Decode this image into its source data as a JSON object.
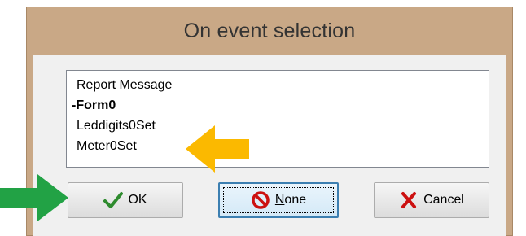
{
  "dialog": {
    "title": "On event selection"
  },
  "event_list": {
    "items": [
      {
        "label": "Report Message",
        "bold": false
      },
      {
        "label": "-Form0",
        "bold": true
      },
      {
        "label": "Leddigits0Set",
        "bold": false
      },
      {
        "label": "Meter0Set",
        "bold": false
      }
    ]
  },
  "buttons": {
    "ok_label": "OK",
    "none_label": "None",
    "none_mnemonic": "N",
    "none_rest": "one",
    "cancel_label": "Cancel"
  },
  "icons": {
    "ok": "checkmark-icon",
    "none": "no-entry-icon",
    "cancel": "x-cross-icon",
    "pointer_ok": "green-arrow-icon",
    "pointer_item": "orange-arrow-icon"
  },
  "colors": {
    "frame": "#c9a886",
    "checkmark": "#2e8b2e",
    "none_icon": "#cc1111",
    "cancel_icon": "#cc1111",
    "green_arrow": "#22a245",
    "orange_arrow": "#fbb900"
  }
}
